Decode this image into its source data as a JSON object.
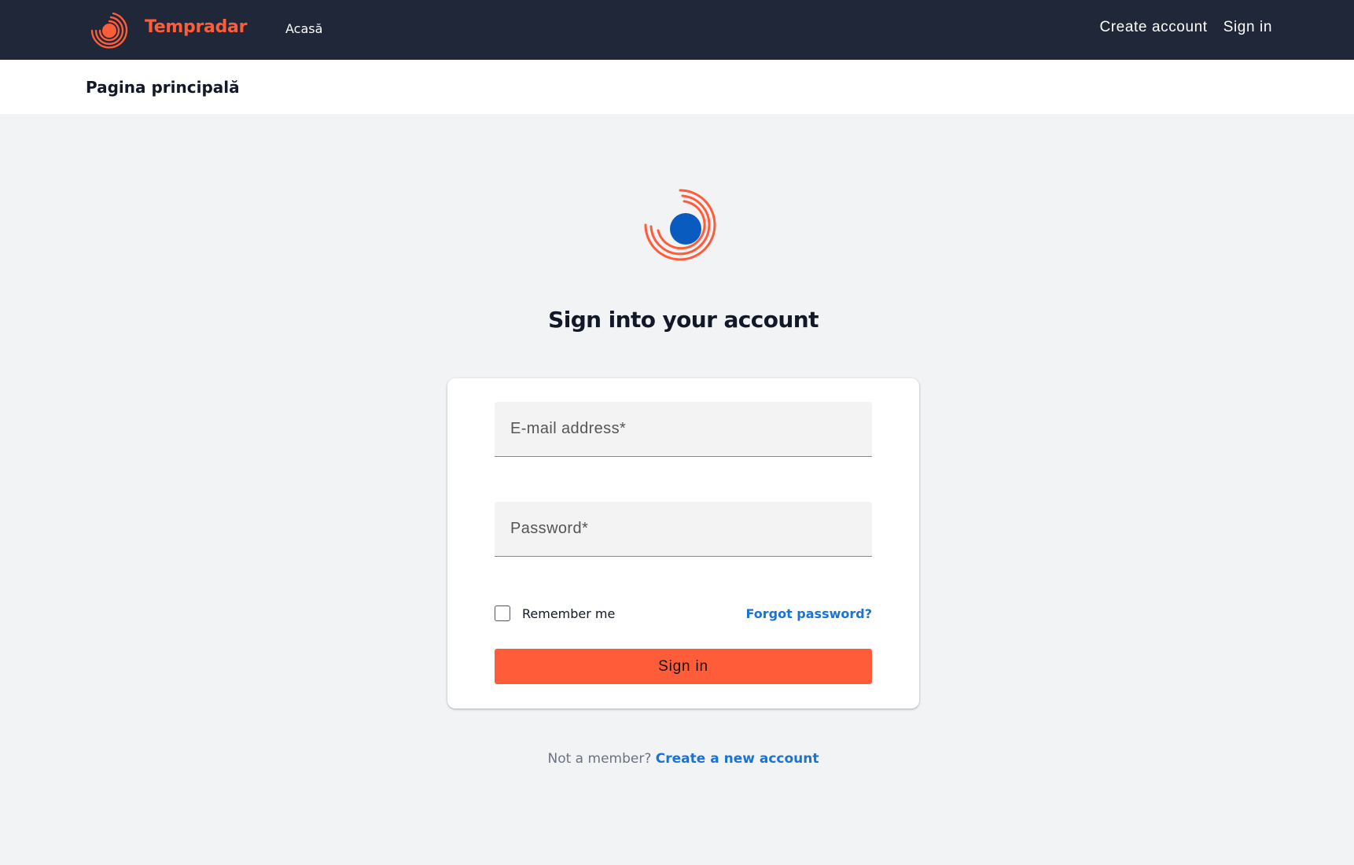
{
  "nav": {
    "brand_name": "Tempradar",
    "home_link": "Acasă",
    "create_account": "Create account",
    "sign_in": "Sign in"
  },
  "subheader": {
    "title": "Pagina principală"
  },
  "form": {
    "heading": "Sign into your account",
    "email_placeholder": "E-mail address*",
    "password_placeholder": "Password*",
    "remember_label": "Remember me",
    "forgot_link": "Forgot password?",
    "submit_label": "Sign in"
  },
  "footer": {
    "prompt": "Not a member?",
    "link": "Create a new account"
  },
  "colors": {
    "navbar_bg": "#1f2738",
    "accent": "#ff5c3a",
    "logo_dot": "#0a5bbf",
    "link": "#1a73d9",
    "page_bg": "#f2f3f5"
  },
  "icons": {
    "brand_logo": "tempradar-logo-icon",
    "center_logo": "tempradar-logo-icon"
  }
}
